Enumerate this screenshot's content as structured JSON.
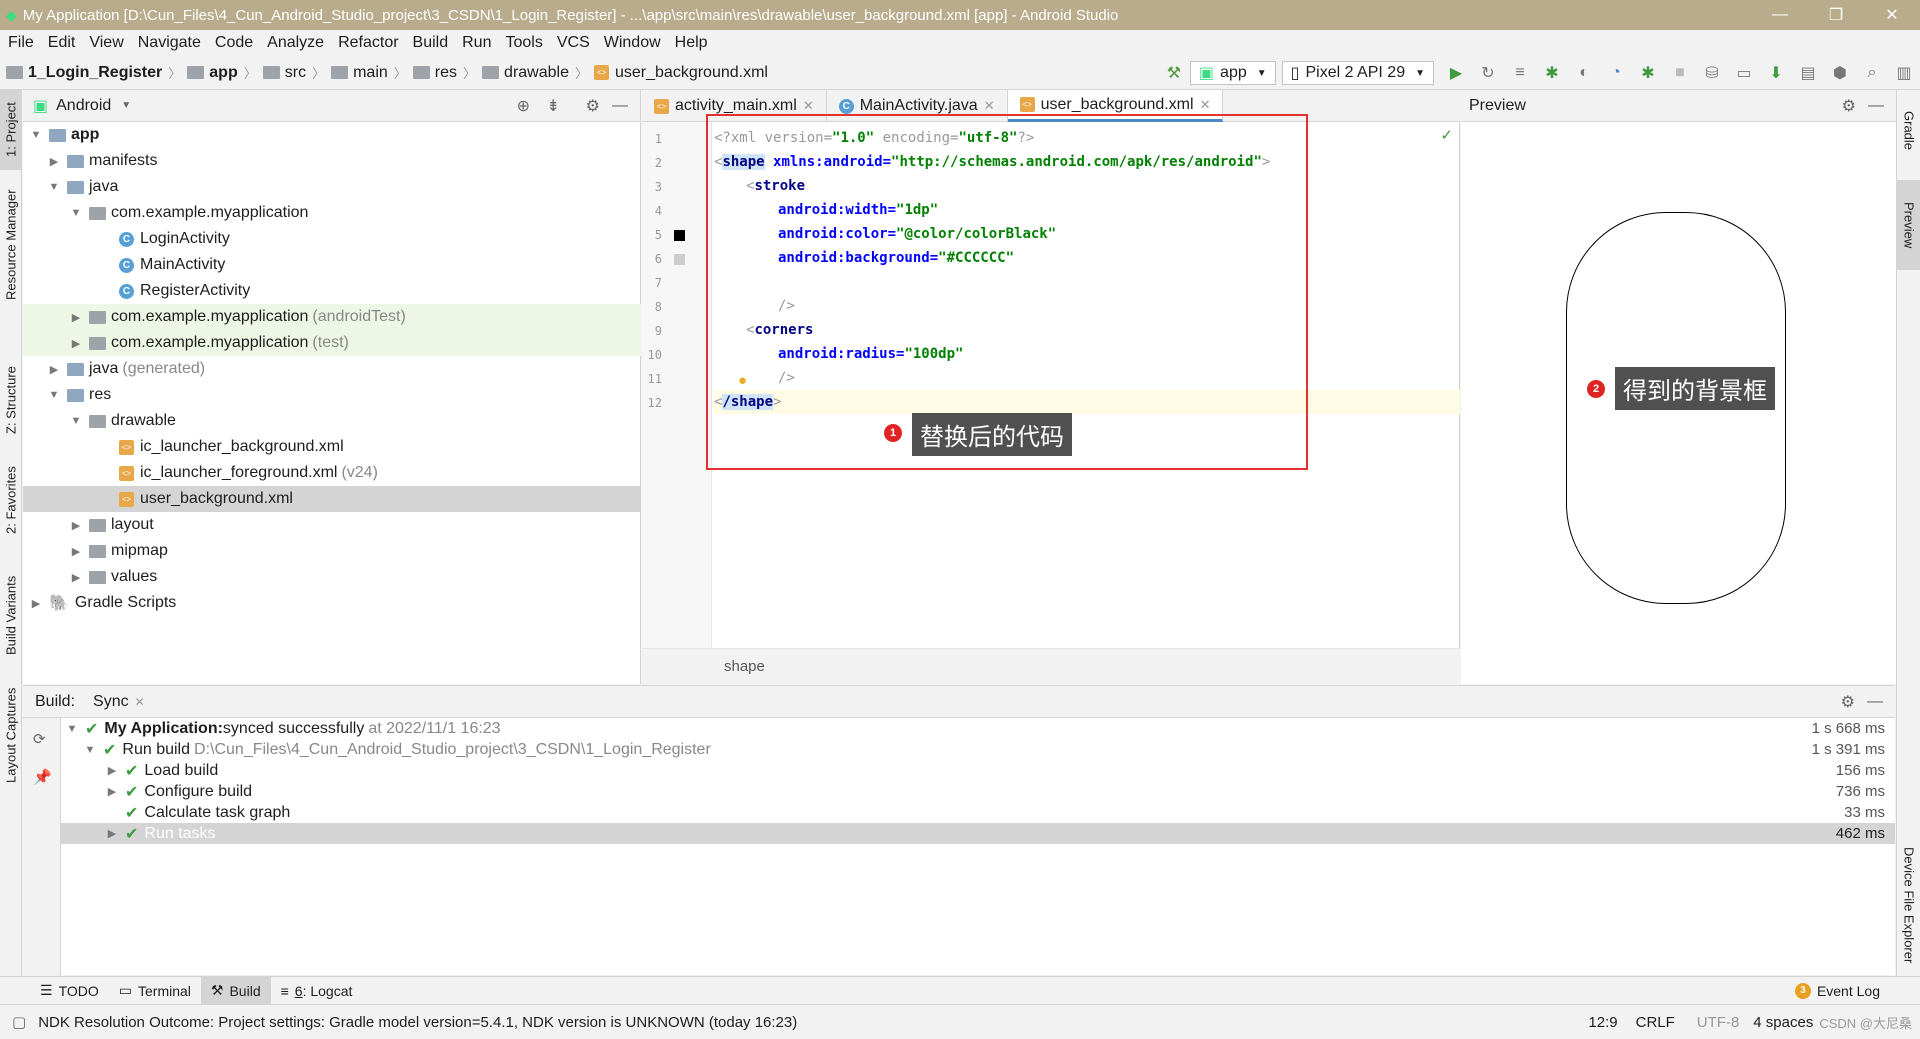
{
  "window": {
    "title": "My Application [D:\\Cun_Files\\4_Cun_Android_Studio_project\\3_CSDN\\1_Login_Register] - ...\\app\\src\\main\\res\\drawable\\user_background.xml [app] - Android Studio",
    "minimize": "—",
    "maximize": "❐",
    "close": "✕"
  },
  "menu": [
    "File",
    "Edit",
    "View",
    "Navigate",
    "Code",
    "Analyze",
    "Refactor",
    "Build",
    "Run",
    "Tools",
    "VCS",
    "Window",
    "Help"
  ],
  "breadcrumb": [
    "1_Login_Register",
    "app",
    "src",
    "main",
    "res",
    "drawable",
    "user_background.xml"
  ],
  "toolbar": {
    "module": "app",
    "device": "Pixel 2 API 29"
  },
  "left_strip": {
    "project": "1: Project",
    "resource_manager": "Resource Manager",
    "structure": "Z: Structure",
    "favorites": "2: Favorites",
    "build_variants": "Build Variants",
    "layout_captures": "Layout Captures"
  },
  "right_strip": {
    "gradle": "Gradle",
    "preview": "Preview",
    "device_file_explorer": "Device File Explorer"
  },
  "project_panel": {
    "view": "Android",
    "tree": [
      {
        "label": "app",
        "suffix": ""
      },
      {
        "label": "manifests",
        "suffix": ""
      },
      {
        "label": "java",
        "suffix": ""
      },
      {
        "label": "com.example.myapplication",
        "suffix": ""
      },
      {
        "label": "LoginActivity",
        "suffix": ""
      },
      {
        "label": "MainActivity",
        "suffix": ""
      },
      {
        "label": "RegisterActivity",
        "suffix": ""
      },
      {
        "label": "com.example.myapplication",
        "suffix": "(androidTest)"
      },
      {
        "label": "com.example.myapplication",
        "suffix": "(test)"
      },
      {
        "label": "java",
        "suffix": "(generated)"
      },
      {
        "label": "res",
        "suffix": ""
      },
      {
        "label": "drawable",
        "suffix": ""
      },
      {
        "label": "ic_launcher_background.xml",
        "suffix": ""
      },
      {
        "label": "ic_launcher_foreground.xml",
        "suffix": "(v24)"
      },
      {
        "label": "user_background.xml",
        "suffix": ""
      },
      {
        "label": "layout",
        "suffix": ""
      },
      {
        "label": "mipmap",
        "suffix": ""
      },
      {
        "label": "values",
        "suffix": ""
      },
      {
        "label": "Gradle Scripts",
        "suffix": ""
      }
    ]
  },
  "editor": {
    "tabs": [
      {
        "label": "activity_main.xml"
      },
      {
        "label": "MainActivity.java"
      },
      {
        "label": "user_background.xml"
      }
    ],
    "line_numbers": [
      "1",
      "2",
      "3",
      "4",
      "5",
      "6",
      "7",
      "8",
      "9",
      "10",
      "11",
      "12"
    ],
    "code": {
      "l1a": "<?xml version=",
      "l1b": "\"1.0\"",
      "l1c": " encoding=",
      "l1d": "\"utf-8\"",
      "l1e": "?>",
      "l2a": "shape",
      "l2b": " xmlns:android=",
      "l2c": "\"http://schemas.android.com/apk/res/android\"",
      "l3": "stroke",
      "l4a": "android:width=",
      "l4b": "\"1dp\"",
      "l5a": "android:color=",
      "l5b": "\"@color/colorBlack\"",
      "l6a": "android:background=",
      "l6b": "\"#CCCCCC\"",
      "l8": "/>",
      "l9": "corners",
      "l10a": "android:radius=",
      "l10b": "\"100dp\"",
      "l11": "/>",
      "l12": "/shape"
    },
    "footer": "shape",
    "callout": "替换后的代码",
    "callout_num": "1"
  },
  "preview": {
    "title": "Preview",
    "callout": "得到的背景框",
    "callout_num": "2"
  },
  "build": {
    "tab_build": "Build:",
    "tab_sync": "Sync",
    "rows": [
      {
        "bold": "My Application:",
        "text": " synced successfully",
        "muted": "at 2022/11/1 16:23",
        "time": "1 s 668 ms"
      },
      {
        "bold": "",
        "text": "Run build ",
        "muted": "D:\\Cun_Files\\4_Cun_Android_Studio_project\\3_CSDN\\1_Login_Register",
        "time": "1 s 391 ms"
      },
      {
        "bold": "",
        "text": "Load build",
        "muted": "",
        "time": "156 ms"
      },
      {
        "bold": "",
        "text": "Configure build",
        "muted": "",
        "time": "736 ms"
      },
      {
        "bold": "",
        "text": "Calculate task graph",
        "muted": "",
        "time": "33 ms"
      },
      {
        "bold": "",
        "text": "Run tasks",
        "muted": "",
        "time": "462 ms"
      }
    ]
  },
  "bottom_tabs": {
    "todo": "TODO",
    "terminal": "Terminal",
    "build": "Build",
    "logcat_num": "6",
    "logcat": ": Logcat",
    "event_log": "Event Log",
    "event_count": "3"
  },
  "status": {
    "message": "NDK Resolution Outcome: Project settings: Gradle model version=5.4.1, NDK version is UNKNOWN (today 16:23)",
    "position": "12:9",
    "line_sep": "CRLF",
    "encoding": "UTF-8",
    "indent": "4 spaces",
    "watermark": "CSDN @大尼桑"
  },
  "colors": {
    "titlebar": "#b8ac8c",
    "accent": "#4a88c7",
    "callout_bg": "#505050",
    "annotation_red": "#e53030",
    "success_green": "#3f9b3f"
  }
}
